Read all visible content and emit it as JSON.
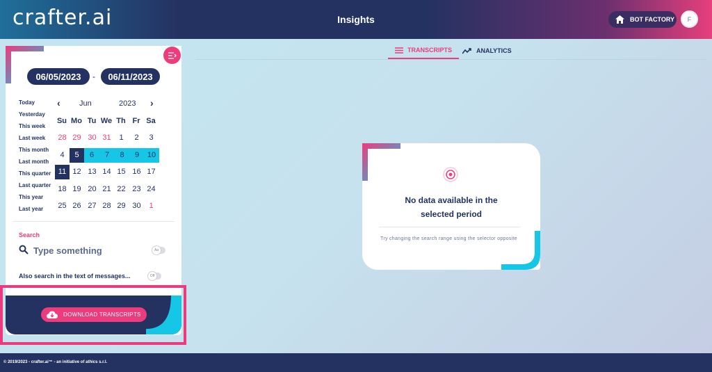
{
  "header": {
    "logo": "crafter.ai",
    "title": "Insights",
    "bot_factory_label": "BOT FACTORY",
    "avatar_initial": "F"
  },
  "sidebar": {
    "date_from": "06/05/2023",
    "date_sep": "-",
    "date_to": "06/11/2023",
    "quick_ranges": [
      "Today",
      "Yesterday",
      "This week",
      "Last week",
      "This month",
      "Last month",
      "This quarter",
      "Last quarter",
      "This year",
      "Last year"
    ],
    "calendar": {
      "month": "Jun",
      "year": "2023",
      "prev": "‹",
      "next": "›",
      "weekdays": [
        "Su",
        "Mo",
        "Tu",
        "We",
        "Th",
        "Fr",
        "Sa"
      ],
      "weeks": [
        [
          "28",
          "29",
          "30",
          "31",
          "1",
          "2",
          "3"
        ],
        [
          "4",
          "5",
          "6",
          "7",
          "8",
          "9",
          "10"
        ],
        [
          "11",
          "12",
          "13",
          "14",
          "15",
          "16",
          "17"
        ],
        [
          "18",
          "19",
          "20",
          "21",
          "22",
          "23",
          "24"
        ],
        [
          "25",
          "26",
          "27",
          "28",
          "29",
          "30",
          "1"
        ]
      ]
    },
    "search_label": "Search",
    "search_placeholder": "Type something",
    "case_toggle": "Aa",
    "also_search_label": "Also search in the text of messages...",
    "also_toggle": "Off"
  },
  "download": {
    "label": "DOWNLOAD TRANSCRIPTS"
  },
  "tabs": [
    {
      "label": "TRANSCRIPTS",
      "icon": "list-icon"
    },
    {
      "label": "ANALYTICS",
      "icon": "trend-icon"
    }
  ],
  "empty_state": {
    "title_line1": "No data available in the",
    "title_line2": "selected period",
    "hint": "Try changing the search range using the selector opposite"
  },
  "footer": {
    "text": "© 2019/2023 - crafter.ai™ - an initiative of athics s.r.l."
  },
  "colors": {
    "navy": "#243262",
    "pink": "#ee3b7c",
    "cyan": "#15c6e6"
  }
}
